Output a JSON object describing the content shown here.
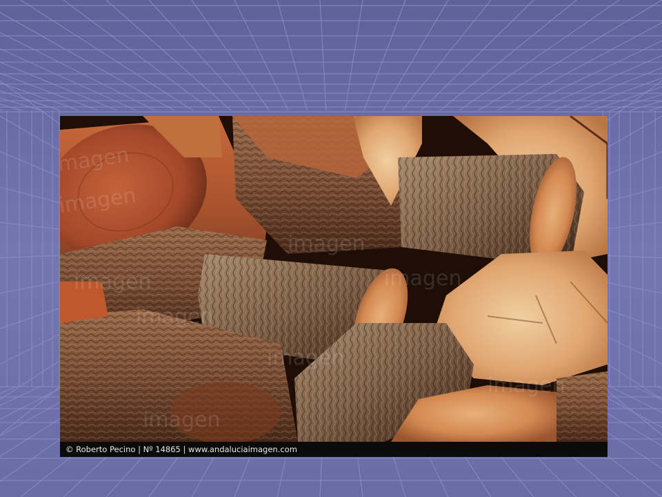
{
  "slide": {
    "background_color": "#6f71ad",
    "grid_line_color": "#8d8fc4"
  },
  "photo": {
    "subject": "stacked firewood logs",
    "watermark_text": "imagen",
    "credit_line": "© Roberto Pecino | Nº 14865 | www.andaluciaimagen.com"
  }
}
